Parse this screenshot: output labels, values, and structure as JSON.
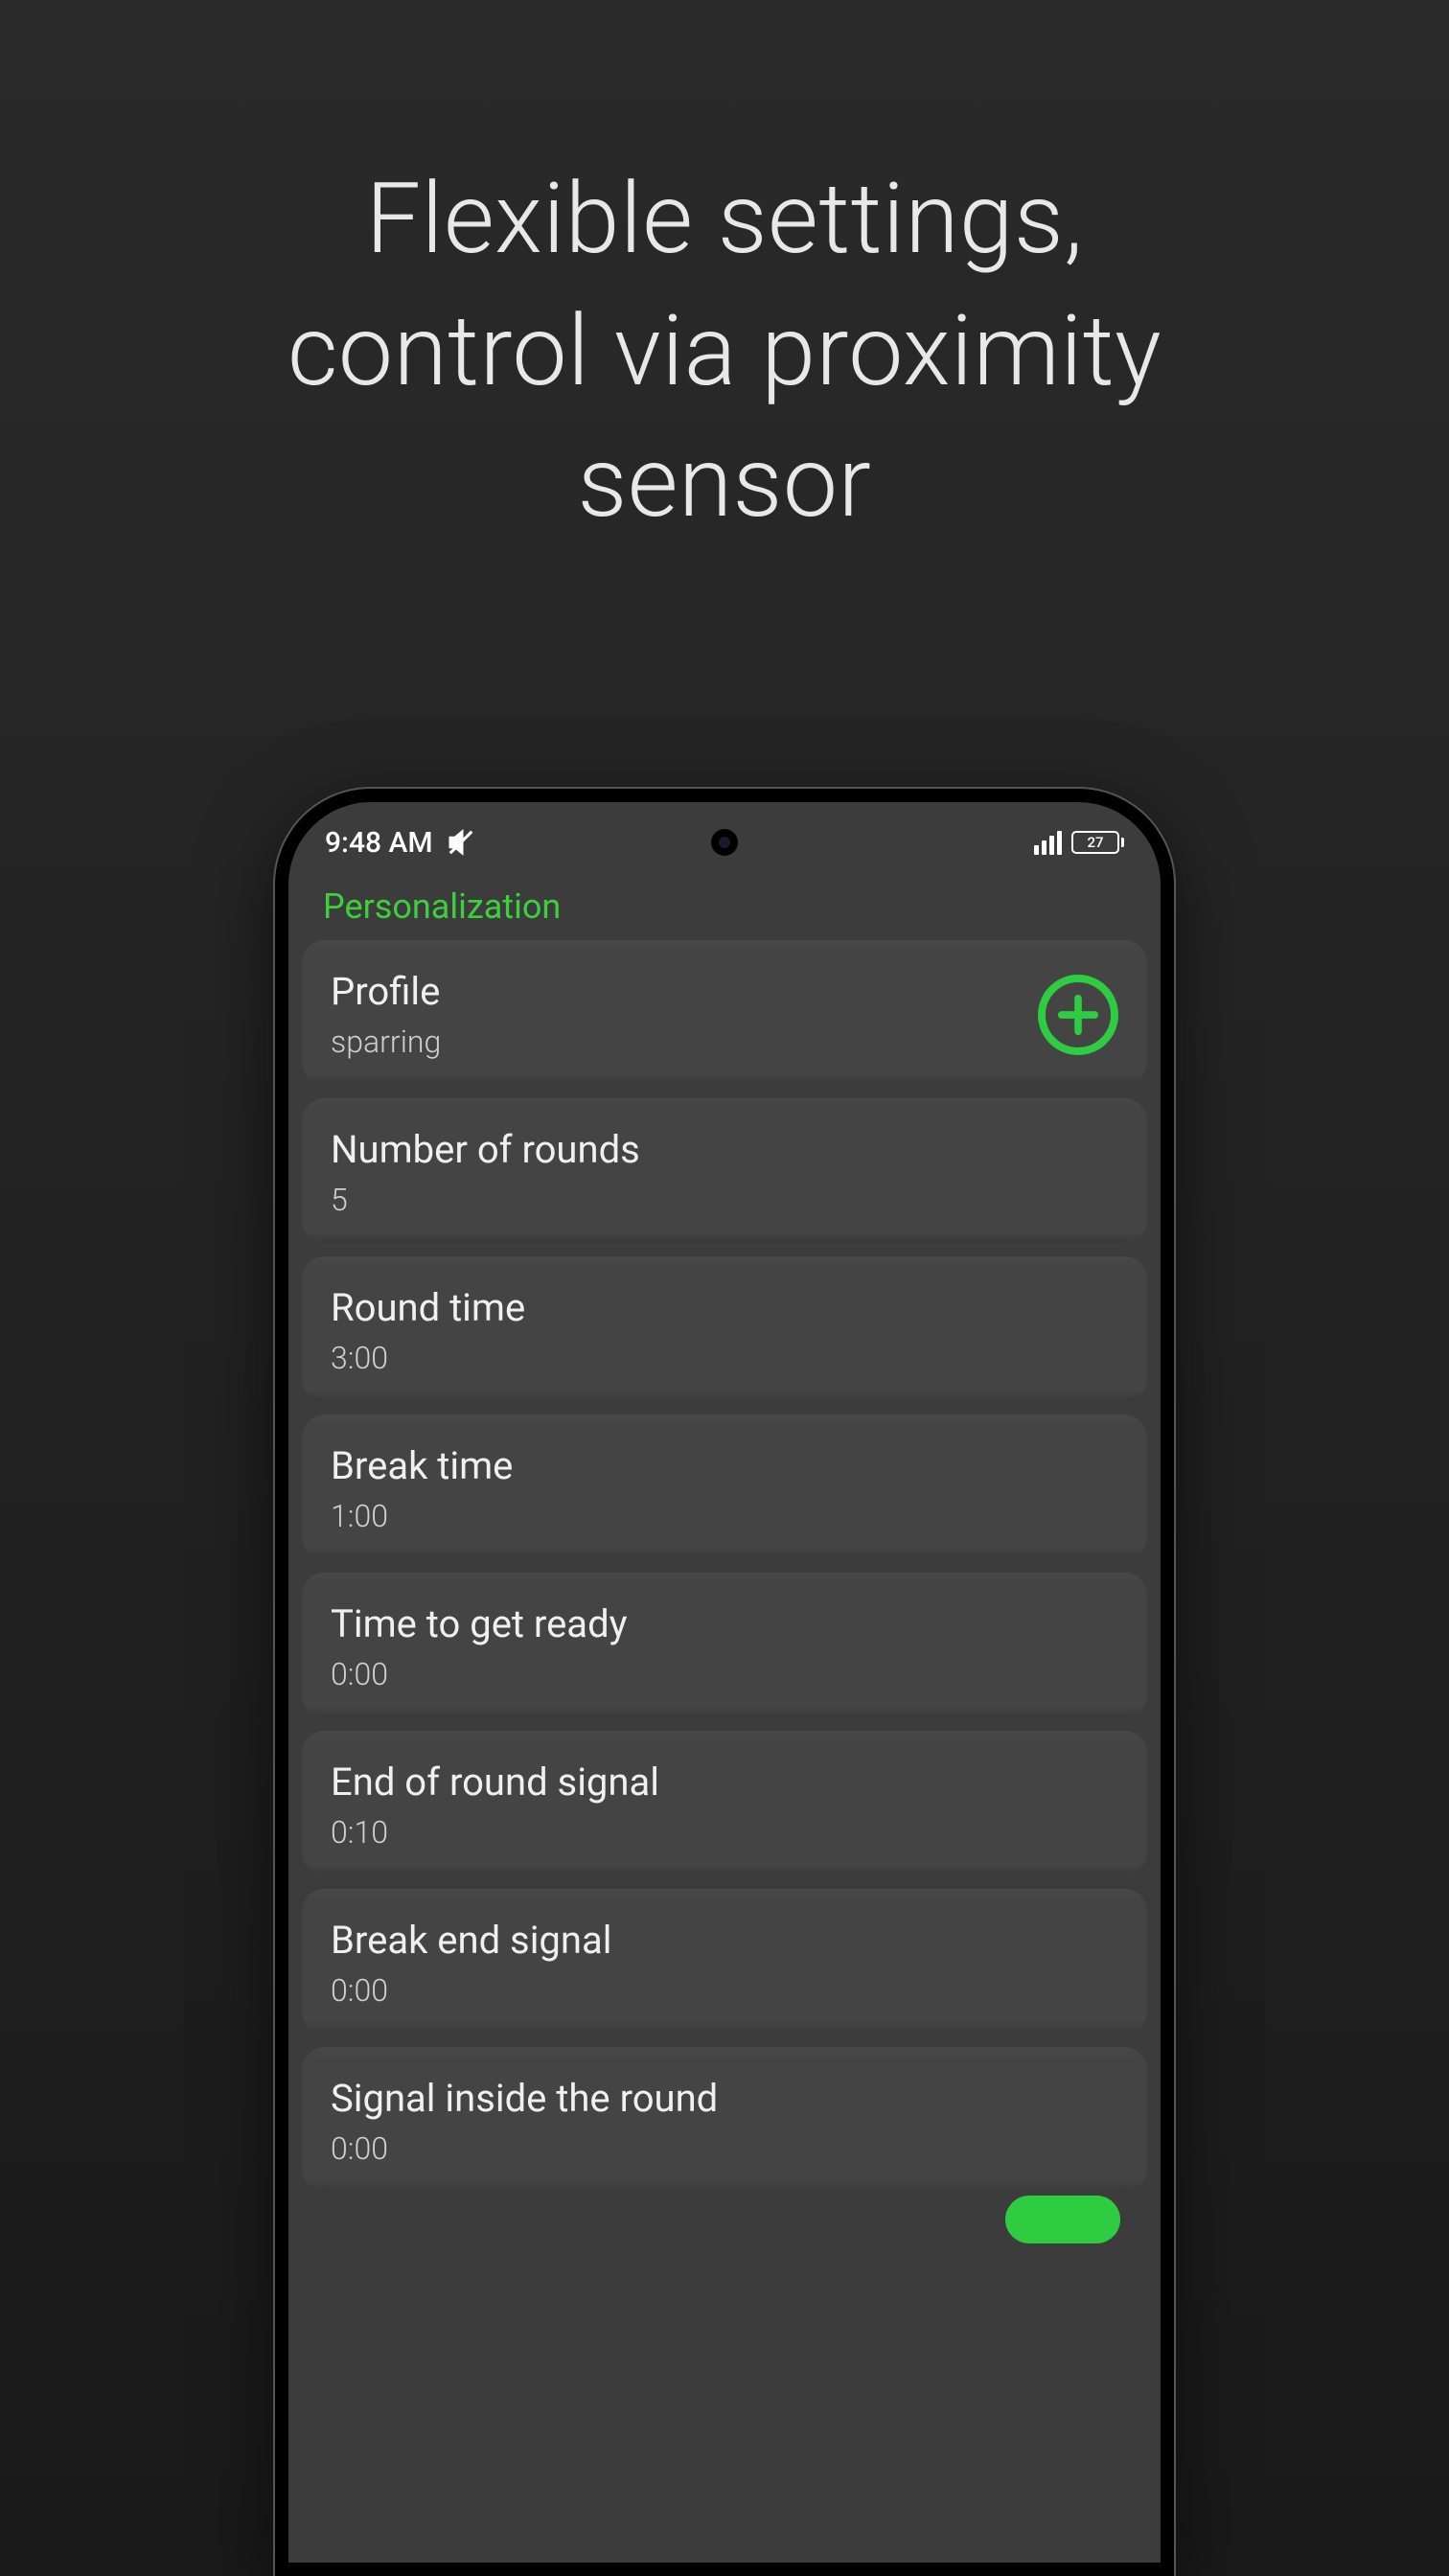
{
  "marketing": {
    "headline_line1": "Flexible settings,",
    "headline_line2": "control via proximity",
    "headline_line3": "sensor"
  },
  "status_bar": {
    "time": "9:48 AM",
    "battery_level": "27"
  },
  "screen": {
    "section_title": "Personalization",
    "settings": [
      {
        "label": "Profile",
        "value": "sparring",
        "has_add": true
      },
      {
        "label": "Number of rounds",
        "value": "5",
        "has_add": false
      },
      {
        "label": "Round time",
        "value": "3:00",
        "has_add": false
      },
      {
        "label": "Break time",
        "value": "1:00",
        "has_add": false
      },
      {
        "label": "Time to get ready",
        "value": "0:00",
        "has_add": false
      },
      {
        "label": "End of round signal",
        "value": "0:10",
        "has_add": false
      },
      {
        "label": "Break end signal",
        "value": "0:00",
        "has_add": false
      },
      {
        "label": "Signal inside the round",
        "value": "0:00",
        "has_add": false
      }
    ]
  },
  "colors": {
    "accent": "#2ecc40",
    "row_bg": "#444444",
    "screen_bg": "#3c3c3c"
  }
}
